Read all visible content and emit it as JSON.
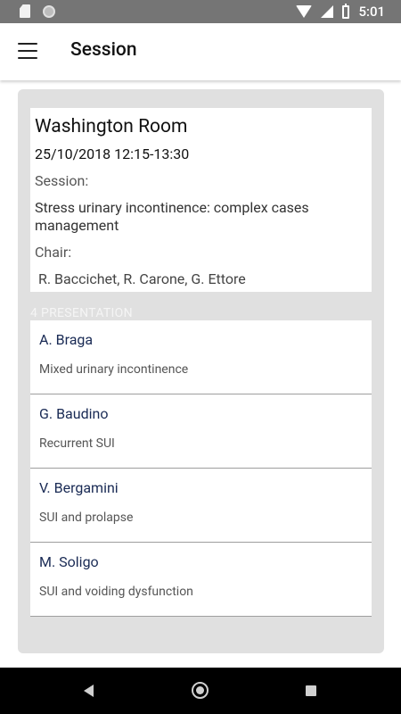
{
  "status_bar": {
    "time": "5:01"
  },
  "app_bar": {
    "title": "Session"
  },
  "session": {
    "room": "Washington Room",
    "datetime": "25/10/2018 12:15-13:30",
    "session_label": "Session:",
    "session_title": "Stress urinary incontinence: complex cases management",
    "chair_label": "Chair:",
    "chair_names": "R. Baccichet, R. Carone, G. Ettore"
  },
  "presentations_header": "4 PRESENTATION",
  "presentations": [
    {
      "author": "A. Braga",
      "topic": "Mixed urinary incontinence"
    },
    {
      "author": "G. Baudino",
      "topic": "Recurrent SUI"
    },
    {
      "author": "V. Bergamini",
      "topic": "SUI and prolapse"
    },
    {
      "author": "M. Soligo",
      "topic": "SUI and voiding dysfunction"
    }
  ],
  "colors": {
    "status_bar": "#757575",
    "panel": "#e0e0e0",
    "author_text": "#1a2b55"
  },
  "icons": {
    "menu": "hamburger-menu-icon",
    "nav_back": "back-triangle-icon",
    "nav_home": "home-circle-icon",
    "nav_recent": "recent-square-icon"
  }
}
